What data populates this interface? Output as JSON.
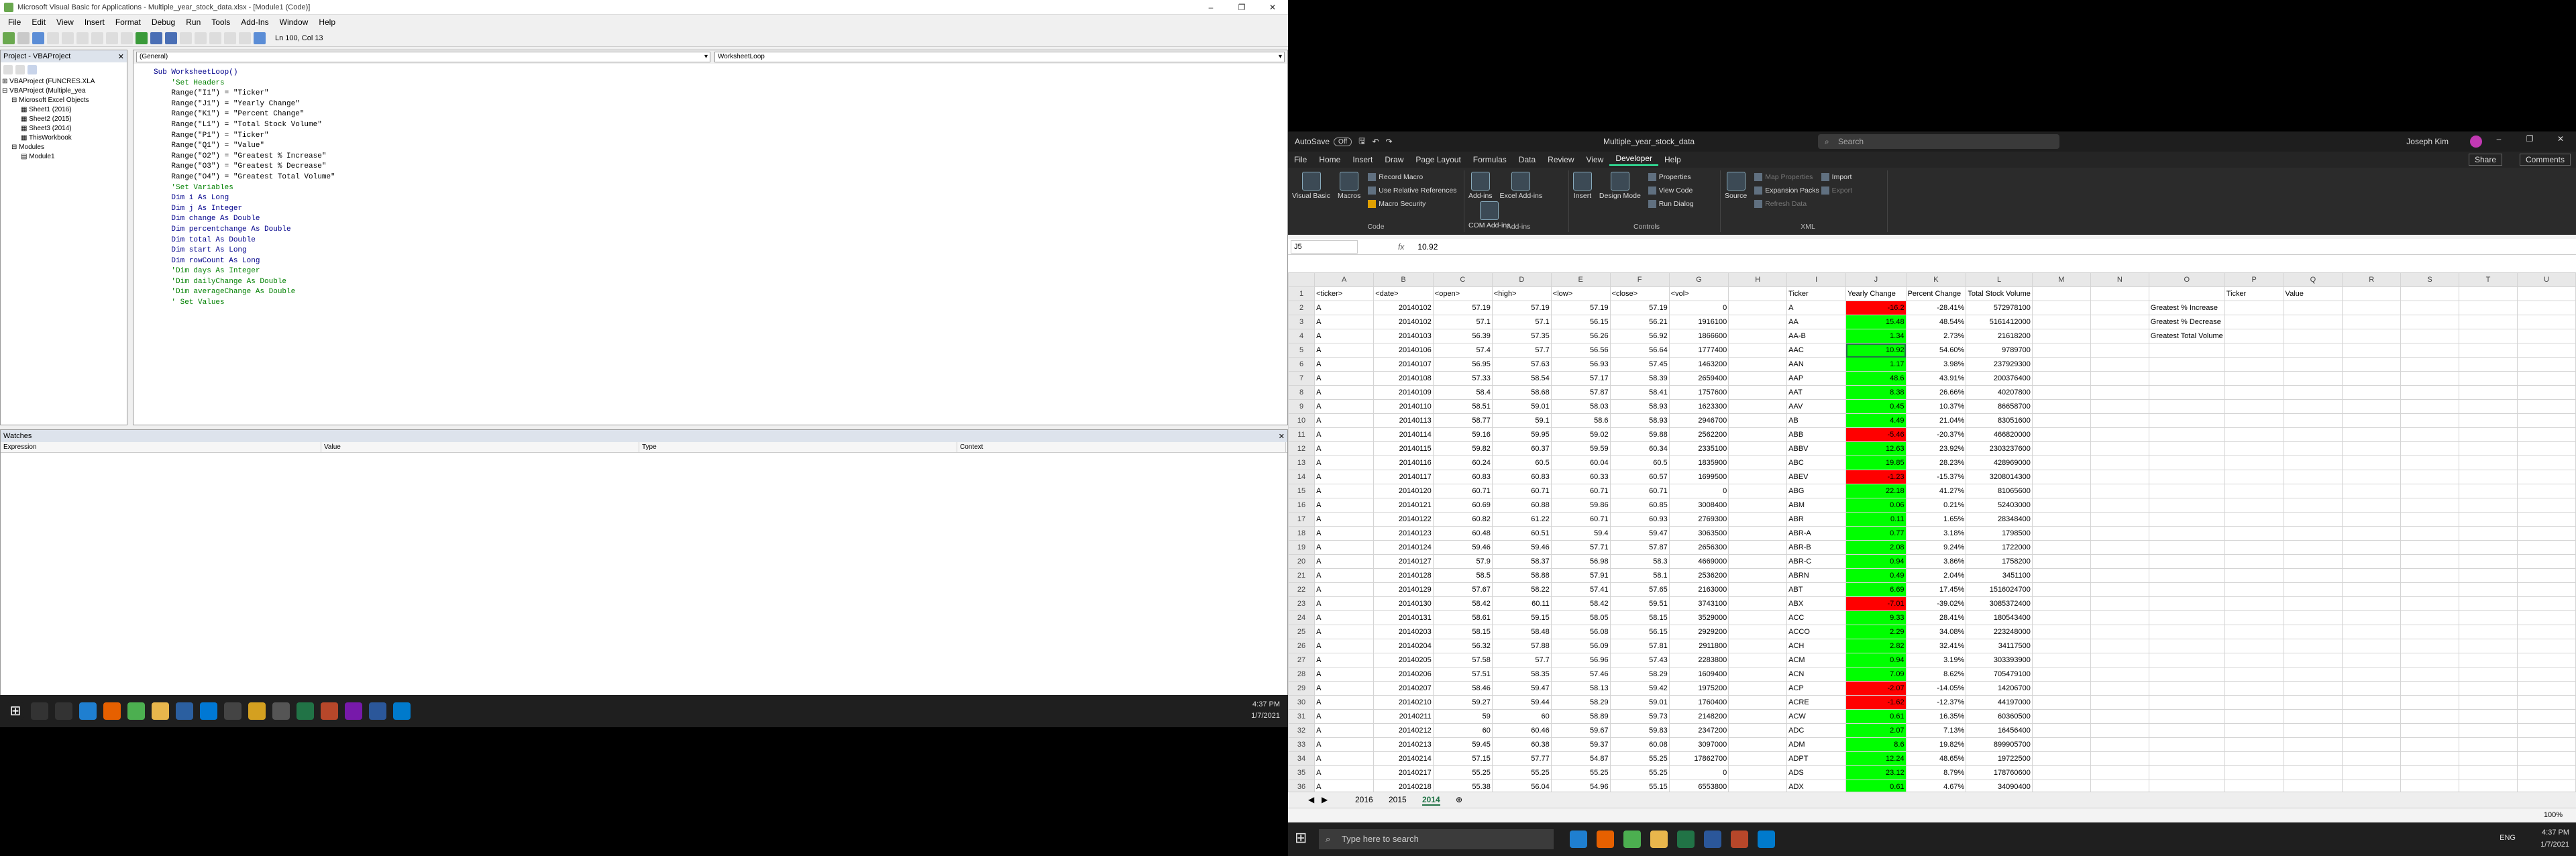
{
  "vbe": {
    "title": "Microsoft Visual Basic for Applications - Multiple_year_stock_data.xlsx - [Module1 (Code)]",
    "menu": [
      "File",
      "Edit",
      "View",
      "Insert",
      "Format",
      "Debug",
      "Run",
      "Tools",
      "Add-Ins",
      "Window",
      "Help"
    ],
    "position": "Ln 100, Col 13",
    "project_title": "Project - VBAProject",
    "tree": [
      "VBAProject (FUNCRES.XLA",
      "VBAProject (Multiple_yea",
      "Microsoft Excel Objects",
      "Sheet1 (2016)",
      "Sheet2 (2015)",
      "Sheet3 (2014)",
      "ThisWorkbook",
      "Modules",
      "Module1"
    ],
    "combo_left": "(General)",
    "combo_right": "WorksheetLoop",
    "code": [
      {
        "t": "Sub WorksheetLoop()",
        "c": "k"
      },
      {
        "t": "",
        "c": ""
      },
      {
        "t": "    'Set Headers",
        "c": "c"
      },
      {
        "t": "    Range(\"I1\") = \"Ticker\"",
        "c": ""
      },
      {
        "t": "    Range(\"J1\") = \"Yearly Change\"",
        "c": ""
      },
      {
        "t": "    Range(\"K1\") = \"Percent Change\"",
        "c": ""
      },
      {
        "t": "    Range(\"L1\") = \"Total Stock Volume\"",
        "c": ""
      },
      {
        "t": "",
        "c": ""
      },
      {
        "t": "    Range(\"P1\") = \"Ticker\"",
        "c": ""
      },
      {
        "t": "    Range(\"Q1\") = \"Value\"",
        "c": ""
      },
      {
        "t": "",
        "c": ""
      },
      {
        "t": "    Range(\"O2\") = \"Greatest % Increase\"",
        "c": ""
      },
      {
        "t": "    Range(\"O3\") = \"Greatest % Decrease\"",
        "c": ""
      },
      {
        "t": "    Range(\"O4\") = \"Greatest Total Volume\"",
        "c": ""
      },
      {
        "t": "",
        "c": ""
      },
      {
        "t": "",
        "c": ""
      },
      {
        "t": "    'Set Variables",
        "c": "c"
      },
      {
        "t": "    Dim i As Long",
        "c": "k"
      },
      {
        "t": "    Dim j As Integer",
        "c": "k"
      },
      {
        "t": "    Dim change As Double",
        "c": "k"
      },
      {
        "t": "    Dim percentchange As Double",
        "c": "k"
      },
      {
        "t": "    Dim total As Double",
        "c": "k"
      },
      {
        "t": "    Dim start As Long",
        "c": "k"
      },
      {
        "t": "    Dim rowCount As Long",
        "c": "k"
      },
      {
        "t": "",
        "c": ""
      },
      {
        "t": "    'Dim days As Integer",
        "c": "c"
      },
      {
        "t": "    'Dim dailyChange As Double",
        "c": "c"
      },
      {
        "t": "    'Dim averageChange As Double",
        "c": "c"
      },
      {
        "t": "",
        "c": ""
      },
      {
        "t": "",
        "c": ""
      },
      {
        "t": "    ' Set Values",
        "c": "c"
      }
    ],
    "watches_title": "Watches",
    "watch_cols": [
      "Expression",
      "Value",
      "Type",
      "Context"
    ],
    "clock_time": "4:37 PM",
    "clock_date": "1/7/2021"
  },
  "excel": {
    "autosave": "AutoSave",
    "autosave_state": "Off",
    "filename": "Multiple_year_stock_data",
    "search": "Search",
    "user": "Joseph Kim",
    "share": "Share",
    "comments": "Comments",
    "tabs": [
      "File",
      "Home",
      "Insert",
      "Draw",
      "Page Layout",
      "Formulas",
      "Data",
      "Review",
      "View",
      "Developer",
      "Help"
    ],
    "active_tab": "Developer",
    "ribbon": {
      "visual_basic": "Visual Basic",
      "macros": "Macros",
      "record_macro": "Record Macro",
      "relative_refs": "Use Relative References",
      "macro_security": "Macro Security",
      "code_group": "Code",
      "addins": "Add-ins",
      "excel_addins": "Excel Add-ins",
      "com_addins": "COM Add-ins",
      "addins_group": "Add-ins",
      "insert": "Insert",
      "design_mode": "Design Mode",
      "properties": "Properties",
      "view_code": "View Code",
      "run_dialog": "Run Dialog",
      "controls_group": "Controls",
      "source": "Source",
      "map_props": "Map Properties",
      "expansion_packs": "Expansion Packs",
      "refresh_data": "Refresh Data",
      "import": "Import",
      "export": "Export",
      "xml_group": "XML"
    },
    "namebox": "J5",
    "formula": "10.92",
    "columns": [
      "A",
      "B",
      "C",
      "D",
      "E",
      "F",
      "G",
      "H",
      "I",
      "J",
      "K",
      "L",
      "M",
      "N",
      "O",
      "P",
      "Q",
      "R",
      "S",
      "T",
      "U"
    ],
    "headers_row1": [
      "<ticker>",
      "<date>",
      "<open>",
      "<high>",
      "<low>",
      "<close>",
      "<vol>",
      "",
      "Ticker",
      "Yearly Change",
      "Percent Change",
      "Total Stock Volume",
      "",
      "",
      "",
      "Ticker",
      "Value",
      "",
      "",
      "",
      ""
    ],
    "summary_labels": [
      "Greatest % Increase",
      "Greatest % Decrease",
      "Greatest Total Volume"
    ],
    "rows": [
      [
        "A",
        "20140102",
        "57.19",
        "57.19",
        "57.19",
        "57.19",
        "0",
        "",
        "A",
        "-16.2",
        "-28.41%",
        "572978100"
      ],
      [
        "A",
        "20140102",
        "57.1",
        "57.1",
        "56.15",
        "56.21",
        "1916100",
        "",
        "AA",
        "15.48",
        "48.54%",
        "5161412000"
      ],
      [
        "A",
        "20140103",
        "56.39",
        "57.35",
        "56.26",
        "56.92",
        "1866600",
        "",
        "AA-B",
        "1.34",
        "2.73%",
        "21618200"
      ],
      [
        "A",
        "20140106",
        "57.4",
        "57.7",
        "56.56",
        "56.64",
        "1777400",
        "",
        "AAC",
        "10.92",
        "54.60%",
        "9789700"
      ],
      [
        "A",
        "20140107",
        "56.95",
        "57.63",
        "56.93",
        "57.45",
        "1463200",
        "",
        "AAN",
        "1.17",
        "3.98%",
        "237929300"
      ],
      [
        "A",
        "20140108",
        "57.33",
        "58.54",
        "57.17",
        "58.39",
        "2659400",
        "",
        "AAP",
        "48.6",
        "43.91%",
        "200376400"
      ],
      [
        "A",
        "20140109",
        "58.4",
        "58.68",
        "57.87",
        "58.41",
        "1757600",
        "",
        "AAT",
        "8.38",
        "26.66%",
        "40207800"
      ],
      [
        "A",
        "20140110",
        "58.51",
        "59.01",
        "58.03",
        "58.93",
        "1623300",
        "",
        "AAV",
        "0.45",
        "10.37%",
        "86658700"
      ],
      [
        "A",
        "20140113",
        "58.77",
        "59.1",
        "58.6",
        "58.93",
        "2946700",
        "",
        "AB",
        "4.49",
        "21.04%",
        "83051600"
      ],
      [
        "A",
        "20140114",
        "59.16",
        "59.95",
        "59.02",
        "59.88",
        "2562200",
        "",
        "ABB",
        "-5.46",
        "-20.37%",
        "466820000"
      ],
      [
        "A",
        "20140115",
        "59.82",
        "60.37",
        "59.59",
        "60.34",
        "2335100",
        "",
        "ABBV",
        "12.63",
        "23.92%",
        "2303237600"
      ],
      [
        "A",
        "20140116",
        "60.24",
        "60.5",
        "60.04",
        "60.5",
        "1835900",
        "",
        "ABC",
        "19.85",
        "28.23%",
        "428969000"
      ],
      [
        "A",
        "20140117",
        "60.83",
        "60.83",
        "60.33",
        "60.57",
        "1699500",
        "",
        "ABEV",
        "-1.23",
        "-15.37%",
        "3208014300"
      ],
      [
        "A",
        "20140120",
        "60.71",
        "60.71",
        "60.71",
        "60.71",
        "0",
        "",
        "ABG",
        "22.18",
        "41.27%",
        "81065600"
      ],
      [
        "A",
        "20140121",
        "60.69",
        "60.88",
        "59.86",
        "60.85",
        "3008400",
        "",
        "ABM",
        "0.06",
        "0.21%",
        "52403000"
      ],
      [
        "A",
        "20140122",
        "60.82",
        "61.22",
        "60.71",
        "60.93",
        "2769300",
        "",
        "ABR",
        "0.11",
        "1.65%",
        "28348400"
      ],
      [
        "A",
        "20140123",
        "60.48",
        "60.51",
        "59.4",
        "59.47",
        "3063500",
        "",
        "ABR-A",
        "0.77",
        "3.18%",
        "1798500"
      ],
      [
        "A",
        "20140124",
        "59.46",
        "59.46",
        "57.71",
        "57.87",
        "2656300",
        "",
        "ABR-B",
        "2.08",
        "9.24%",
        "1722000"
      ],
      [
        "A",
        "20140127",
        "57.9",
        "58.37",
        "56.98",
        "58.3",
        "4669000",
        "",
        "ABR-C",
        "0.94",
        "3.86%",
        "1758200"
      ],
      [
        "A",
        "20140128",
        "58.5",
        "58.88",
        "57.91",
        "58.1",
        "2536200",
        "",
        "ABRN",
        "0.49",
        "2.04%",
        "3451100"
      ],
      [
        "A",
        "20140129",
        "57.67",
        "58.22",
        "57.41",
        "57.65",
        "2163000",
        "",
        "ABT",
        "6.69",
        "17.45%",
        "1516024700"
      ],
      [
        "A",
        "20140130",
        "58.42",
        "60.11",
        "58.42",
        "59.51",
        "3743100",
        "",
        "ABX",
        "-7.01",
        "-39.02%",
        "3085372400"
      ],
      [
        "A",
        "20140131",
        "58.61",
        "59.15",
        "58.05",
        "58.15",
        "3529000",
        "",
        "ACC",
        "9.33",
        "28.41%",
        "180543400"
      ],
      [
        "A",
        "20140203",
        "58.15",
        "58.48",
        "56.08",
        "56.15",
        "2929200",
        "",
        "ACCO",
        "2.29",
        "34.08%",
        "223248000"
      ],
      [
        "A",
        "20140204",
        "56.32",
        "57.88",
        "56.09",
        "57.81",
        "2911800",
        "",
        "ACH",
        "2.82",
        "32.41%",
        "34117500"
      ],
      [
        "A",
        "20140205",
        "57.58",
        "57.7",
        "56.96",
        "57.43",
        "2283800",
        "",
        "ACM",
        "0.94",
        "3.19%",
        "303393900"
      ],
      [
        "A",
        "20140206",
        "57.51",
        "58.35",
        "57.46",
        "58.29",
        "1609400",
        "",
        "ACN",
        "7.09",
        "8.62%",
        "705479100"
      ],
      [
        "A",
        "20140207",
        "58.46",
        "59.47",
        "58.13",
        "59.42",
        "1975200",
        "",
        "ACP",
        "-2.07",
        "-14.05%",
        "14206700"
      ],
      [
        "A",
        "20140210",
        "59.27",
        "59.44",
        "58.29",
        "59.01",
        "1760400",
        "",
        "ACRE",
        "-1.62",
        "-12.37%",
        "44197000"
      ],
      [
        "A",
        "20140211",
        "59",
        "60",
        "58.89",
        "59.73",
        "2148200",
        "",
        "ACW",
        "0.61",
        "16.35%",
        "60360500"
      ],
      [
        "A",
        "20140212",
        "60",
        "60.46",
        "59.67",
        "59.83",
        "2347200",
        "",
        "ADC",
        "2.07",
        "7.13%",
        "16456400"
      ],
      [
        "A",
        "20140213",
        "59.45",
        "60.38",
        "59.37",
        "60.08",
        "3097000",
        "",
        "ADM",
        "8.6",
        "19.82%",
        "899905700"
      ],
      [
        "A",
        "20140214",
        "57.15",
        "57.77",
        "54.87",
        "55.25",
        "17862700",
        "",
        "ADPT",
        "12.24",
        "48.65%",
        "19722500"
      ],
      [
        "A",
        "20140217",
        "55.25",
        "55.25",
        "55.25",
        "55.25",
        "0",
        "",
        "ADS",
        "23.12",
        "8.79%",
        "178760600"
      ],
      [
        "A",
        "20140218",
        "55.38",
        "56.04",
        "54.96",
        "55.15",
        "6553800",
        "",
        "ADX",
        "0.61",
        "4.67%",
        "34090400"
      ]
    ],
    "sheets": [
      "2016",
      "2015",
      "2014"
    ],
    "active_sheet": "2014",
    "zoom": "100%",
    "taskbar_search": "Type here to search",
    "clock_time": "4:37 PM",
    "clock_date": "1/7/2021",
    "lang": "ENG",
    "colors": {
      "positive": "#00ff00",
      "negative": "#ff0000",
      "accent": "#217346"
    }
  }
}
